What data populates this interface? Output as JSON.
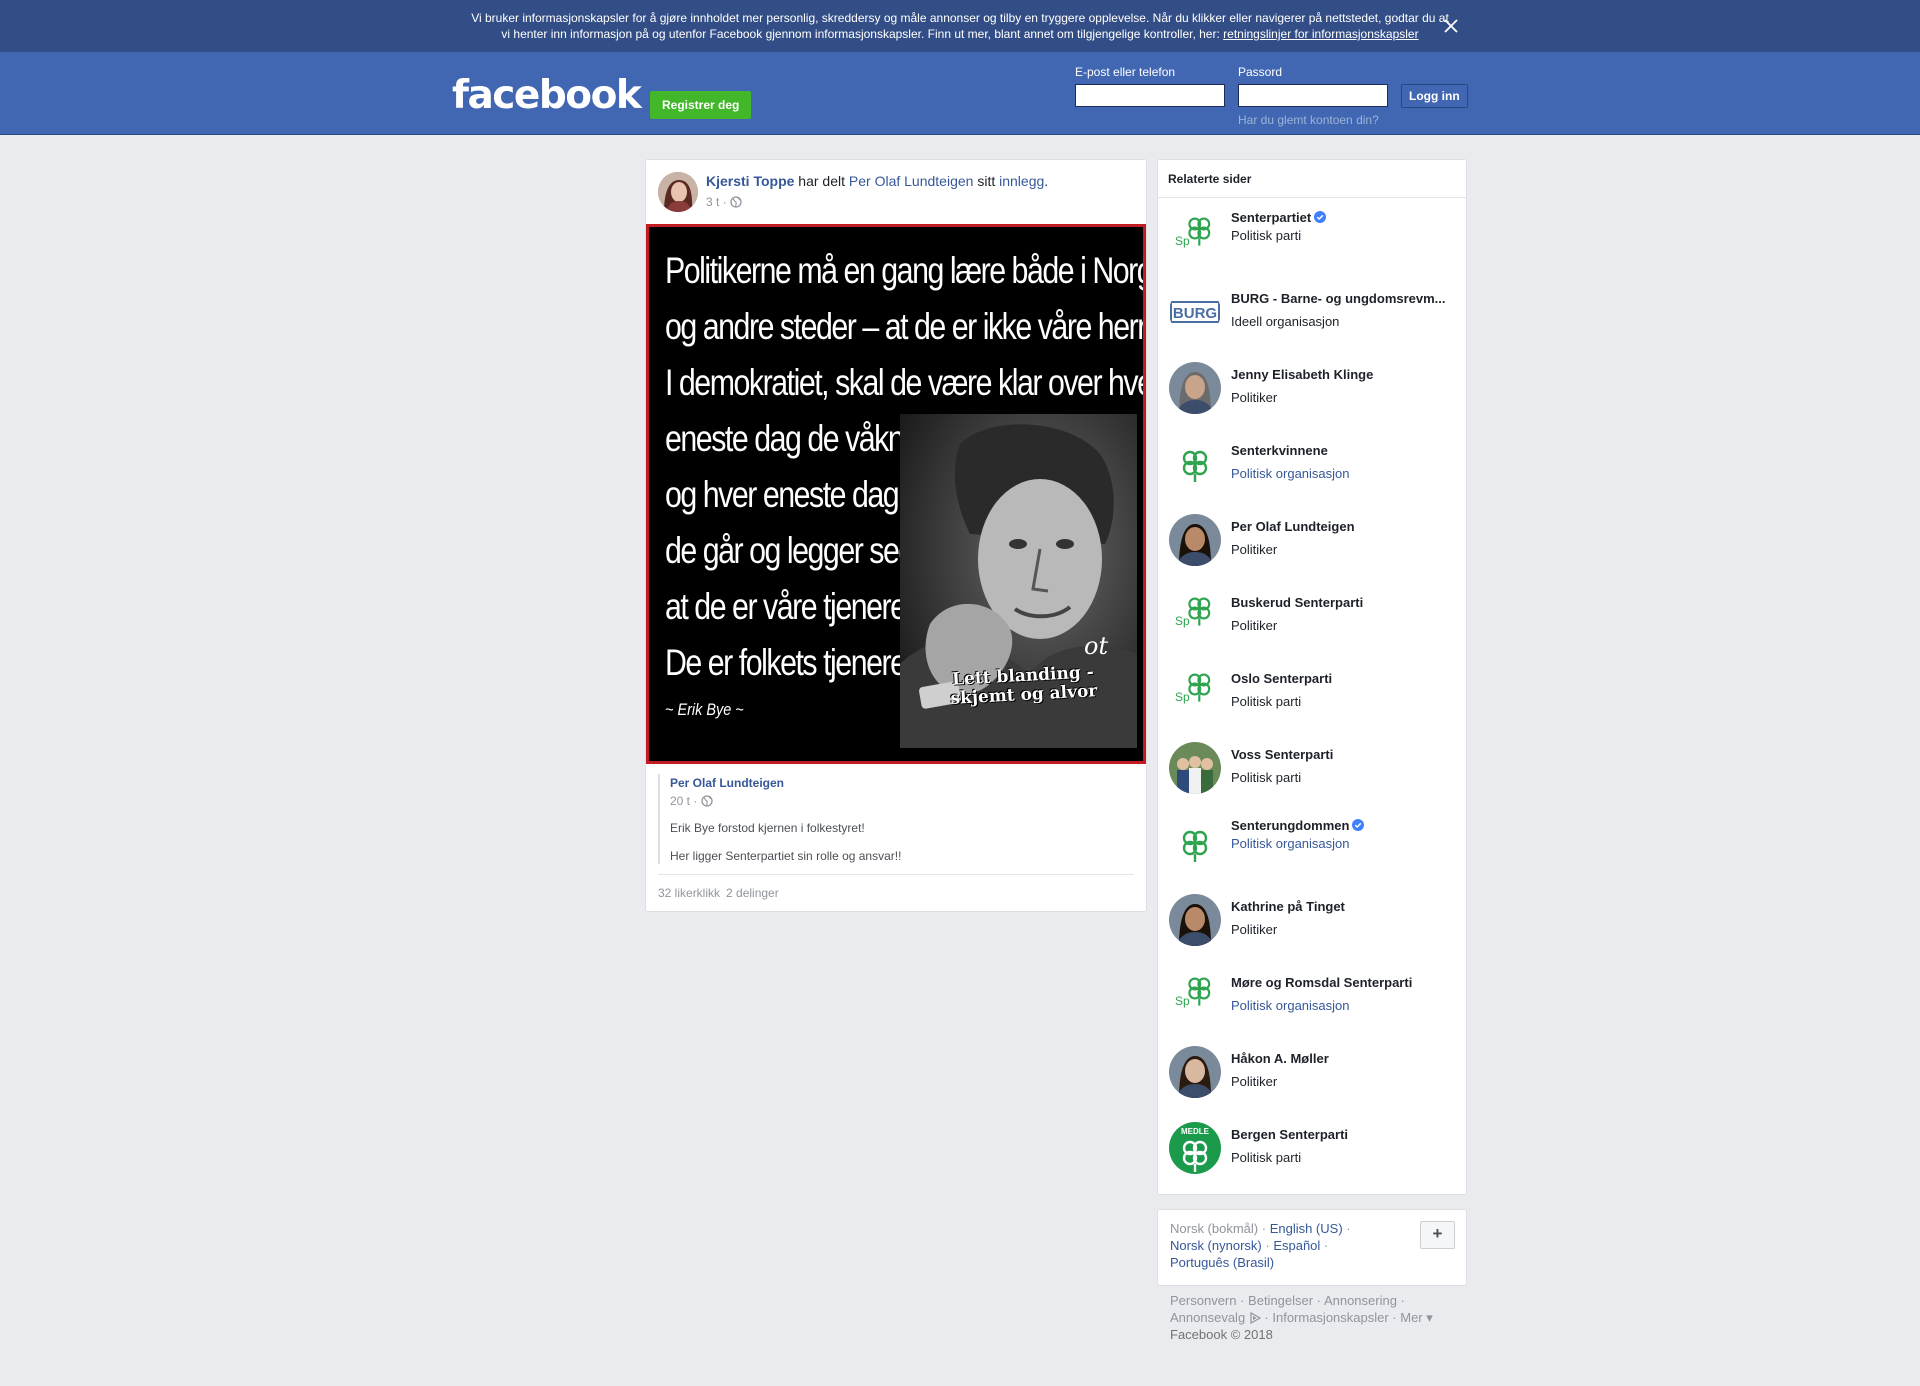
{
  "cookie_banner": {
    "line1": "Vi bruker informasjonskapsler for å gjøre innholdet mer personlig, skreddersy og måle annonser og tilby en tryggere opplevelse. Når du klikker eller navigerer på nettstedet, godtar du at",
    "line2": "vi henter inn informasjon på og utenfor Facebook gjennom informasjonskapsler. Finn ut mer, blant annet om tilgjengelige kontroller, her: ",
    "link": "retningslinjer for informasjonskapsler"
  },
  "header": {
    "logo": "facebook",
    "register": "Registrer deg",
    "email_label": "E-post eller telefon",
    "password_label": "Passord",
    "login_button": "Logg inn",
    "forgot": "Har du glemt kontoen din?"
  },
  "post": {
    "author": "Kjersti Toppe",
    "shared_text": " har delt ",
    "shared_from": "Per Olaf Lundteigen",
    "shared_suffix": " sitt ",
    "post_link": "innlegg",
    "period": ".",
    "time": "3 t · ",
    "image": {
      "quote_lines": [
        "Politikerne må en gang lære både i Norge",
        "og andre steder – at de er ikke våre herrer.",
        "I demokratiet, skal de være klar over hver",
        "eneste dag de våkner",
        "og hver eneste dag",
        "de går og legger seg,",
        "at de er våre tjenere.",
        "De er folkets tjenere."
      ],
      "signature": "~ Erik Bye ~",
      "caption_line1": "Lett blanding -",
      "caption_line2": "skjemt og alvor",
      "watermark": "ot"
    },
    "shared_post": {
      "author": "Per Olaf Lundteigen",
      "time": "20 t · ",
      "lines": [
        "Erik Bye forstod kjernen i folkestyret!",
        "Her ligger Senterpartiet sin rolle og ansvar!!"
      ]
    },
    "likes": "32 likerklikk",
    "shares": "2 delinger"
  },
  "related": {
    "title": "Relaterte sider",
    "items": [
      {
        "name": "Senterpartiet",
        "sub": "Politisk parti",
        "verified": true,
        "link": false,
        "thumb": "sp-logo"
      },
      {
        "name": "BURG - Barne- og ungdomsrevm...",
        "sub": "Ideell organisasjon",
        "verified": false,
        "link": false,
        "thumb": "burg-logo"
      },
      {
        "name": "Jenny Elisabeth Klinge",
        "sub": "Politiker",
        "verified": false,
        "link": false,
        "thumb": "person"
      },
      {
        "name": "Senterkvinnene",
        "sub": "Politisk organisasjon",
        "verified": false,
        "link": true,
        "thumb": "clover"
      },
      {
        "name": "Per Olaf Lundteigen",
        "sub": "Politiker",
        "verified": false,
        "link": false,
        "thumb": "person"
      },
      {
        "name": "Buskerud Senterparti",
        "sub": "Politiker",
        "verified": false,
        "link": false,
        "thumb": "sp-logo"
      },
      {
        "name": "Oslo Senterparti",
        "sub": "Politisk parti",
        "verified": false,
        "link": false,
        "thumb": "sp-logo"
      },
      {
        "name": "Voss Senterparti",
        "sub": "Politisk parti",
        "verified": false,
        "link": false,
        "thumb": "group"
      },
      {
        "name": "Senterungdommen",
        "sub": "Politisk organisasjon",
        "verified": true,
        "link": true,
        "thumb": "clover"
      },
      {
        "name": "Kathrine på Tinget",
        "sub": "Politiker",
        "verified": false,
        "link": false,
        "thumb": "person"
      },
      {
        "name": "Møre og Romsdal Senterparti",
        "sub": "Politisk organisasjon",
        "verified": false,
        "link": true,
        "thumb": "sp-logo"
      },
      {
        "name": "Håkon A. Møller",
        "sub": "Politiker",
        "verified": false,
        "link": false,
        "thumb": "person"
      },
      {
        "name": "Bergen Senterparti",
        "sub": "Politisk parti",
        "verified": false,
        "link": false,
        "thumb": "green-badge"
      }
    ]
  },
  "languages": {
    "current": "Norsk (bokmål)",
    "options": [
      "English (US)",
      "Norsk (nynorsk)",
      "Español",
      "Português (Brasil)"
    ],
    "plus": "+"
  },
  "footer": {
    "links": [
      "Personvern",
      "Betingelser",
      "Annonsering",
      "Annonsevalg",
      "Informasjonskapsler",
      "Mer"
    ],
    "copyright": "Facebook © 2018"
  },
  "colors": {
    "brand_blue": "#4267b2",
    "banner_blue": "#334e86",
    "register_green": "#42b72a",
    "link_blue": "#365899",
    "image_border_red": "#c11b24"
  }
}
